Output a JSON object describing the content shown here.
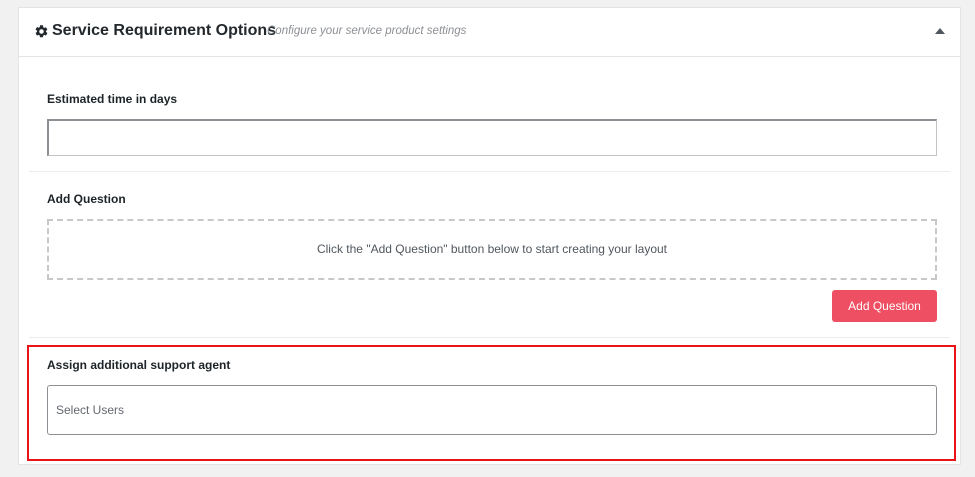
{
  "panel": {
    "title": "Service Requirement Options",
    "subtitle": "Configure your service product settings",
    "header_icon": "gear-icon",
    "toggle_icon": "caret-up-icon"
  },
  "estimated_time": {
    "label": "Estimated time in days",
    "value": "",
    "placeholder": ""
  },
  "questions": {
    "label": "Add Question",
    "empty_message": "Click the \"Add Question\" button below to start creating your layout",
    "add_button_label": "Add Question"
  },
  "support_agent": {
    "label": "Assign additional support agent",
    "placeholder": "Select Users"
  },
  "colors": {
    "accent_button": "#ef4f62",
    "highlight_border": "#e8141a"
  }
}
